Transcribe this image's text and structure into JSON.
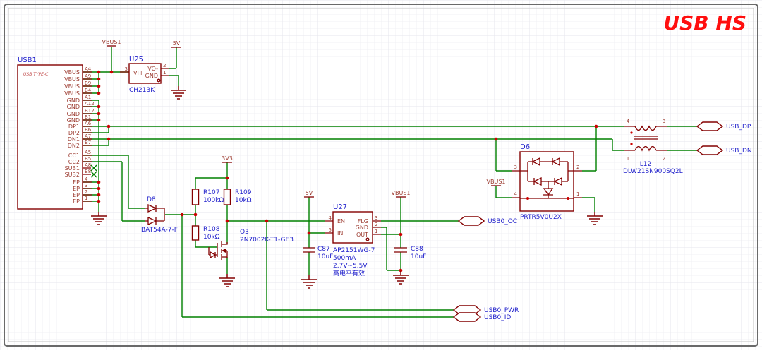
{
  "title": "USB HS",
  "colors": {
    "wire": "#008000",
    "symbol": "#840000",
    "label": "#2222CC",
    "pin_text": "#9C3B30",
    "junction": "#CC0000",
    "title": "#FF0F0F"
  },
  "usb1": {
    "ref": "USB1",
    "type_label": "USB TYPE-C",
    "pins": [
      {
        "name": "VBUS",
        "num": "A4"
      },
      {
        "name": "VBUS",
        "num": "A9"
      },
      {
        "name": "VBUS",
        "num": "B9"
      },
      {
        "name": "VBUS",
        "num": "B4"
      },
      {
        "name": "GND",
        "num": "A1"
      },
      {
        "name": "GND",
        "num": "A12"
      },
      {
        "name": "GND",
        "num": "B12"
      },
      {
        "name": "GND",
        "num": "B1"
      },
      {
        "name": "DP1",
        "num": "A6"
      },
      {
        "name": "DP2",
        "num": "B6"
      },
      {
        "name": "DN1",
        "num": "A7"
      },
      {
        "name": "DN2",
        "num": "B7"
      },
      {
        "name": "CC1",
        "num": "A5"
      },
      {
        "name": "CC2",
        "num": "B5"
      },
      {
        "name": "SUB1",
        "num": "A8"
      },
      {
        "name": "SUB2",
        "num": "B8"
      },
      {
        "name": "EP",
        "num": "4"
      },
      {
        "name": "EP",
        "num": "3"
      },
      {
        "name": "EP",
        "num": "2"
      },
      {
        "name": "EP",
        "num": "1"
      }
    ]
  },
  "u25": {
    "ref": "U25",
    "part": "CH213K",
    "pin_vi": "VI+",
    "pin_vo": "VO-",
    "pin_gnd": "GND",
    "num3": "3",
    "num2": "2",
    "num1": "1"
  },
  "flags": {
    "vbus1": "VBUS1",
    "v5": "5V",
    "v3v3": "3V3"
  },
  "d8": {
    "ref": "D8",
    "part": "BAT54A-7-F"
  },
  "r107": {
    "ref": "R107",
    "value": "100kΩ"
  },
  "r108": {
    "ref": "R108",
    "value": "10kΩ"
  },
  "r109": {
    "ref": "R109",
    "value": "10kΩ"
  },
  "q3": {
    "ref": "Q3",
    "part": "2N7002K-T1-GE3"
  },
  "u27": {
    "ref": "U27",
    "part": "AP2151WG-7",
    "current": "500mA",
    "voltage": "2.7V~5.5V",
    "note": "高电平有效",
    "pin_en": "EN",
    "pin_in": "IN",
    "pin_flg": "FLG",
    "pin_gnd": "GND",
    "pin_out": "OUT",
    "num4": "4",
    "num5": "5",
    "num3": "3",
    "num2": "2",
    "num1": "1"
  },
  "c87": {
    "ref": "C87",
    "value": "10uF"
  },
  "c88": {
    "ref": "C88",
    "value": "10uF"
  },
  "d6": {
    "ref": "D6",
    "part": "PRTR5V0U2X",
    "num1": "1",
    "num2": "2",
    "num3": "3",
    "num4": "4"
  },
  "l12": {
    "ref": "L12",
    "part": "DLW21SN900SQ2L",
    "num1": "1",
    "num2": "2",
    "num3": "3",
    "num4": "4"
  },
  "ports": {
    "usb_dp": "USB_DP",
    "usb_dn": "USB_DN",
    "usb0_oc": "USB0_OC",
    "usb0_pwr": "USB0_PWR",
    "usb0_id": "USB0_ID"
  }
}
